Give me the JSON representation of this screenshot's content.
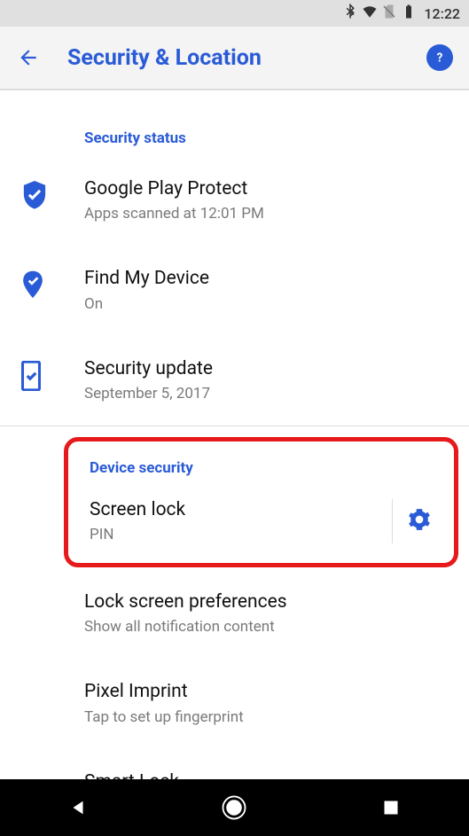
{
  "statusbar": {
    "time": "12:22"
  },
  "appbar": {
    "title": "Security & Location"
  },
  "section1": {
    "header": "Security status",
    "items": [
      {
        "title": "Google Play Protect",
        "sub": "Apps scanned at 12:01 PM"
      },
      {
        "title": "Find My Device",
        "sub": "On"
      },
      {
        "title": "Security update",
        "sub": "September 5, 2017"
      }
    ]
  },
  "section2": {
    "header": "Device security",
    "items": [
      {
        "title": "Screen lock",
        "sub": "PIN"
      },
      {
        "title": "Lock screen preferences",
        "sub": "Show all notification content"
      },
      {
        "title": "Pixel Imprint",
        "sub": "Tap to set up fingerprint"
      },
      {
        "title": "Smart Lock"
      }
    ]
  }
}
